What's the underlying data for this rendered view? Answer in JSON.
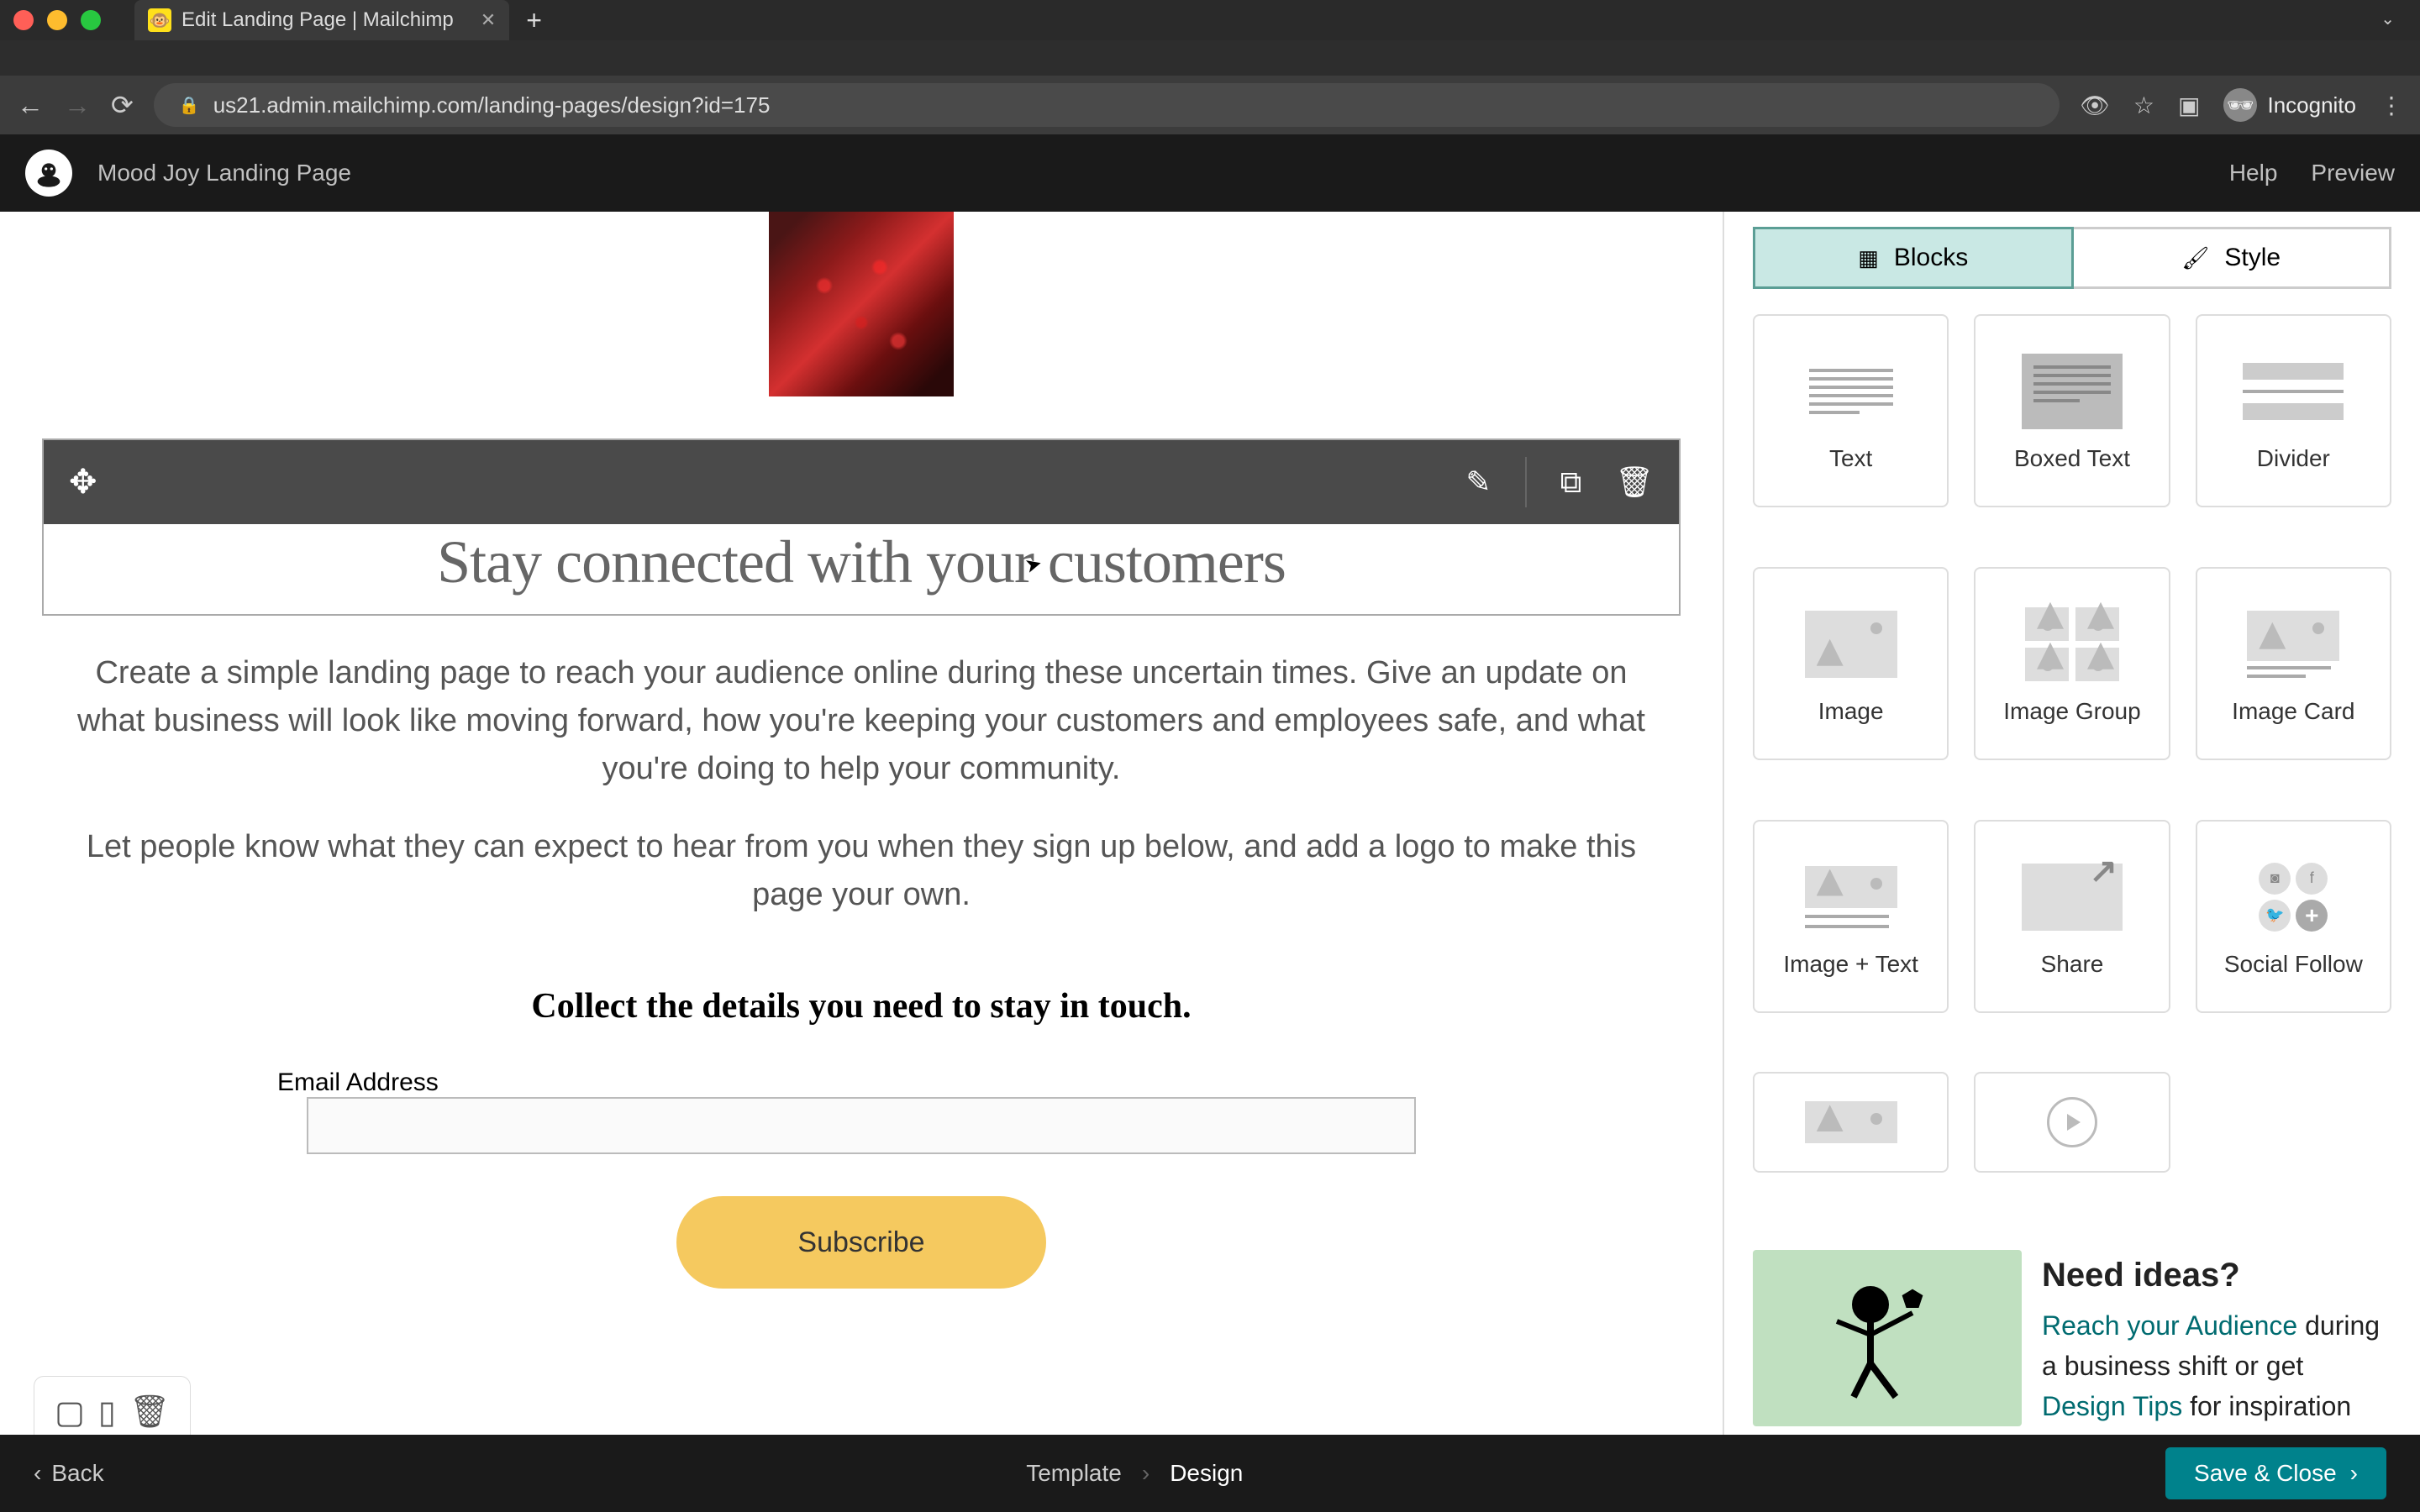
{
  "browser": {
    "tab_title": "Edit Landing Page | Mailchimp",
    "url": "us21.admin.mailchimp.com/landing-pages/design?id=175",
    "incognito_label": "Incognito"
  },
  "header": {
    "page_name": "Mood Joy Landing Page",
    "help": "Help",
    "preview": "Preview"
  },
  "canvas": {
    "headline": "Stay connected with your customers",
    "body1": "Create a simple landing page to reach your audience online during these uncertain times. Give an update on what business will look like moving forward, how you're keeping your customers and employees safe, and what you're doing to help your community.",
    "body2": "Let people know what they can expect to hear from you when they sign up below, and add a logo to make this page your own.",
    "form_heading": "Collect the details you need to stay in touch.",
    "email_label": "Email Address",
    "subscribe": "Subscribe"
  },
  "sidebar": {
    "tabs": {
      "blocks": "Blocks",
      "style": "Style"
    },
    "blocks": [
      "Text",
      "Boxed Text",
      "Divider",
      "Image",
      "Image Group",
      "Image Card",
      "Image + Text",
      "Share",
      "Social Follow"
    ],
    "ideas": {
      "title": "Need ideas?",
      "link1": "Reach your Audience",
      "text1": " during a business shift or get ",
      "link2": "Design Tips",
      "text2": " for inspiration"
    }
  },
  "footer": {
    "back": "Back",
    "crumb1": "Template",
    "crumb2": "Design",
    "save": "Save & Close"
  }
}
